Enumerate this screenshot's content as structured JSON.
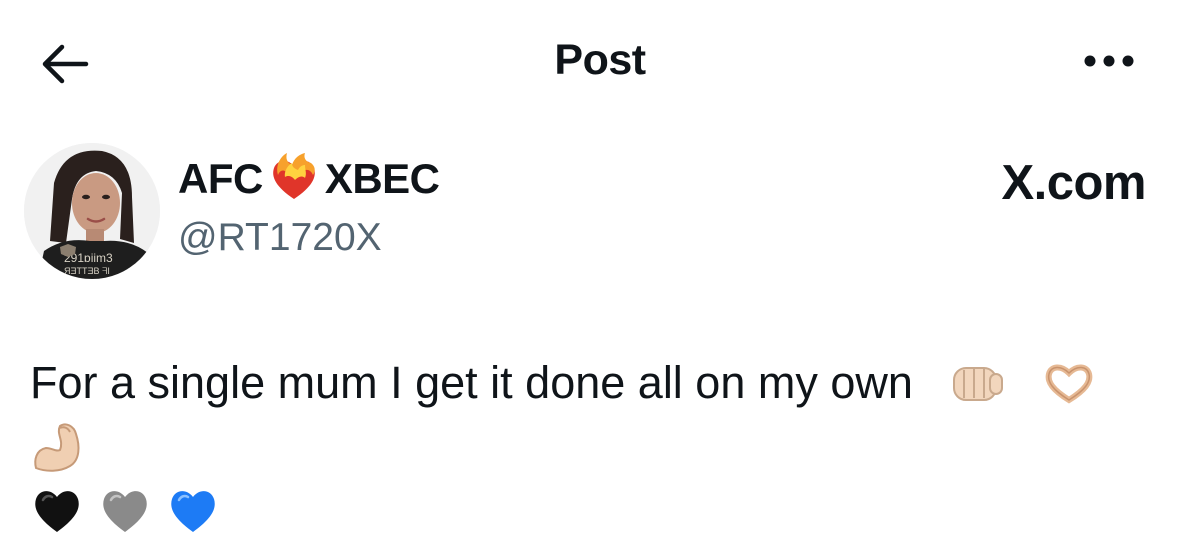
{
  "header": {
    "back_icon": "arrow-left-icon",
    "title": "Post",
    "more_icon": "more-horizontal-icon"
  },
  "author": {
    "name_part1": "AFC",
    "name_emoji": "heart-on-fire-icon",
    "name_part2": "XBEC",
    "handle": "@RT1720X"
  },
  "source_label": "X.com",
  "post": {
    "text": "For a single mum I get it done all on my own",
    "inline_emojis": [
      "oncoming-fist-icon",
      "heart-hands-icon"
    ],
    "line2_emojis": [
      "flexed-biceps-icon"
    ],
    "line3_emojis": [
      "black-heart-icon",
      "grey-heart-icon",
      "blue-heart-icon"
    ]
  },
  "colors": {
    "text_primary": "#0f1419",
    "text_secondary": "#536471",
    "blue_heart": "#1d7bf5",
    "grey_heart": "#8a8a8a",
    "black_heart": "#111111"
  }
}
